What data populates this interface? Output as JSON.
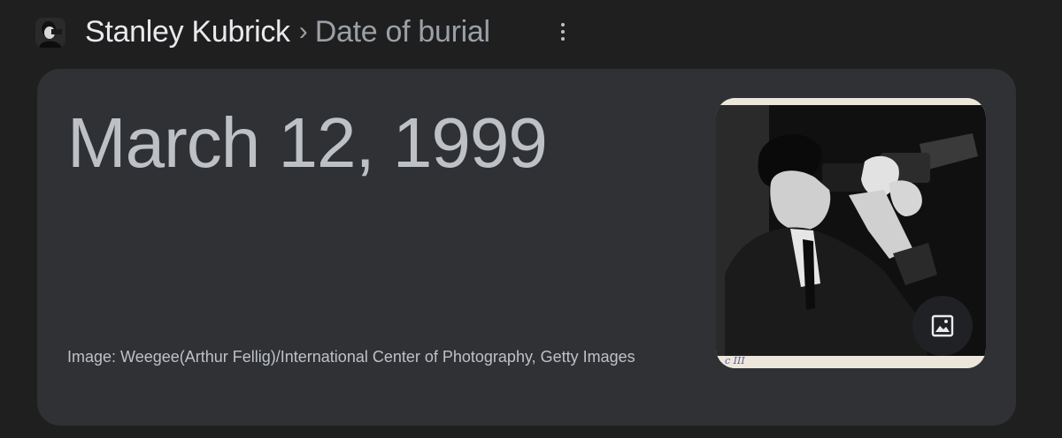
{
  "header": {
    "entity": "Stanley Kubrick",
    "separator": "›",
    "attribute": "Date of burial",
    "entity_thumb_icon": "person-thumbnail",
    "more_icon": "more-vert-icon"
  },
  "card": {
    "answer": "March 12, 1999",
    "image_credit": "Image: Weegee(Arthur Fellig)/International Center of Photography, Getty Images",
    "image_button_icon": "image-icon"
  },
  "colors": {
    "page_background": "#1f1f1f",
    "card_background": "#303134",
    "primary_text": "#e8eaed",
    "secondary_text": "#9aa0a6",
    "answer_text": "#bdc1c6"
  }
}
